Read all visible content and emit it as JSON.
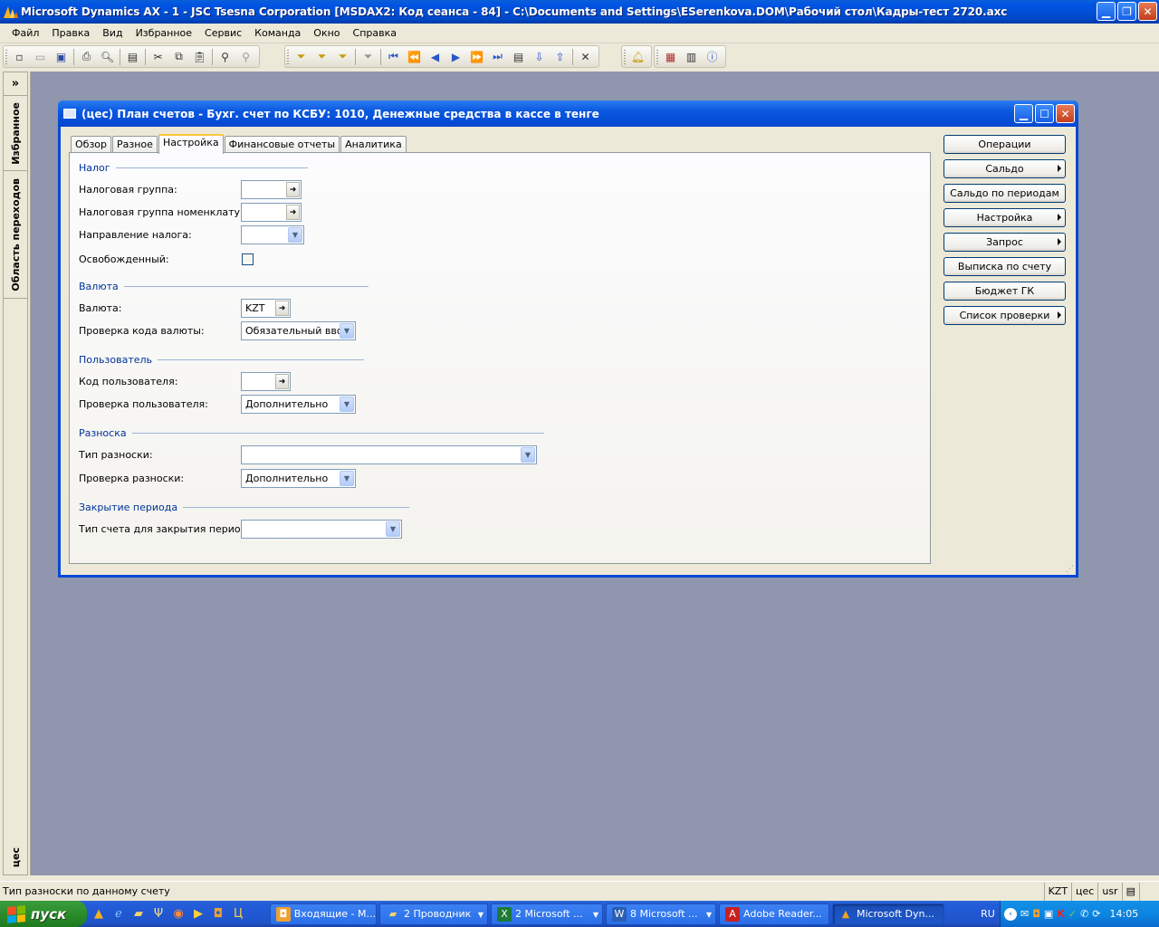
{
  "window": {
    "title": "Microsoft Dynamics AX - 1 - JSC Tsesna Corporation [MSDAX2: Код сеанса - 84] - C:\\Documents and Settings\\ESerenkova.DOM\\Рабочий стол\\Кадры-тест 2720.axc"
  },
  "menu": [
    "Файл",
    "Правка",
    "Вид",
    "Избранное",
    "Сервис",
    "Команда",
    "Окно",
    "Справка"
  ],
  "sidenav": {
    "favorites": "Избранное",
    "navigation": "Область переходов",
    "company": "цес"
  },
  "form": {
    "title": "(цес) План счетов - Бухг. счет по КСБУ: 1010, Денежные средства в кассе в тенге",
    "tabs": [
      "Обзор",
      "Разное",
      "Настройка",
      "Финансовые отчеты",
      "Аналитика"
    ],
    "active_tab": "Настройка",
    "groups": {
      "tax": {
        "title": "Налог",
        "tax_group_label": "Налоговая группа:",
        "tax_group_value": "",
        "item_tax_group_label": "Налоговая группа номенклатур:",
        "item_tax_group_value": "",
        "tax_direction_label": "Направление налога:",
        "tax_direction_value": "",
        "exempt_label": "Освобожденный:",
        "exempt_checked": false
      },
      "currency": {
        "title": "Валюта",
        "currency_label": "Валюта:",
        "currency_value": "KZT",
        "currency_check_label": "Проверка кода валюты:",
        "currency_check_value": "Обязательный ввод"
      },
      "user": {
        "title": "Пользователь",
        "user_code_label": "Код пользователя:",
        "user_code_value": "",
        "user_check_label": "Проверка пользователя:",
        "user_check_value": "Дополнительно"
      },
      "posting": {
        "title": "Разноска",
        "posting_type_label": "Тип разноски:",
        "posting_type_value": "",
        "posting_check_label": "Проверка разноски:",
        "posting_check_value": "Дополнительно"
      },
      "closing": {
        "title": "Закрытие периода",
        "closing_type_label": "Тип счета для закрытия периода:",
        "closing_type_value": ""
      }
    },
    "buttons": [
      {
        "label": "Операции",
        "arrow": false
      },
      {
        "label": "Сальдо",
        "arrow": true
      },
      {
        "label": "Сальдо по периодам",
        "arrow": false
      },
      {
        "label": "Настройка",
        "arrow": true
      },
      {
        "label": "Запрос",
        "arrow": true
      },
      {
        "label": "Выписка по счету",
        "arrow": false
      },
      {
        "label": "Бюджет ГК",
        "arrow": false
      },
      {
        "label": "Список проверки",
        "arrow": true
      }
    ]
  },
  "statusbar": {
    "help_text": "Тип разноски по данному счету",
    "currency": "KZT",
    "company": "цес",
    "user": "usr"
  },
  "taskbar": {
    "start_label": "пуск",
    "tasks": [
      {
        "label": "Входящие - M...",
        "icon": "outlook-icon",
        "color": "#f0a030"
      },
      {
        "label": "2 Проводник",
        "icon": "folder-icon",
        "color": "#f3d36b"
      },
      {
        "label": "2 Microsoft ...",
        "icon": "excel-icon",
        "color": "#1d7a38"
      },
      {
        "label": "8 Microsoft ...",
        "icon": "word-icon",
        "color": "#2b5fb4"
      },
      {
        "label": "Adobe Reader...",
        "icon": "adobe-icon",
        "color": "#c8201e"
      },
      {
        "label": "Microsoft Dyn...",
        "icon": "dynamics-icon",
        "color": "#f0a020"
      }
    ],
    "language": "RU",
    "clock": "14:05"
  }
}
